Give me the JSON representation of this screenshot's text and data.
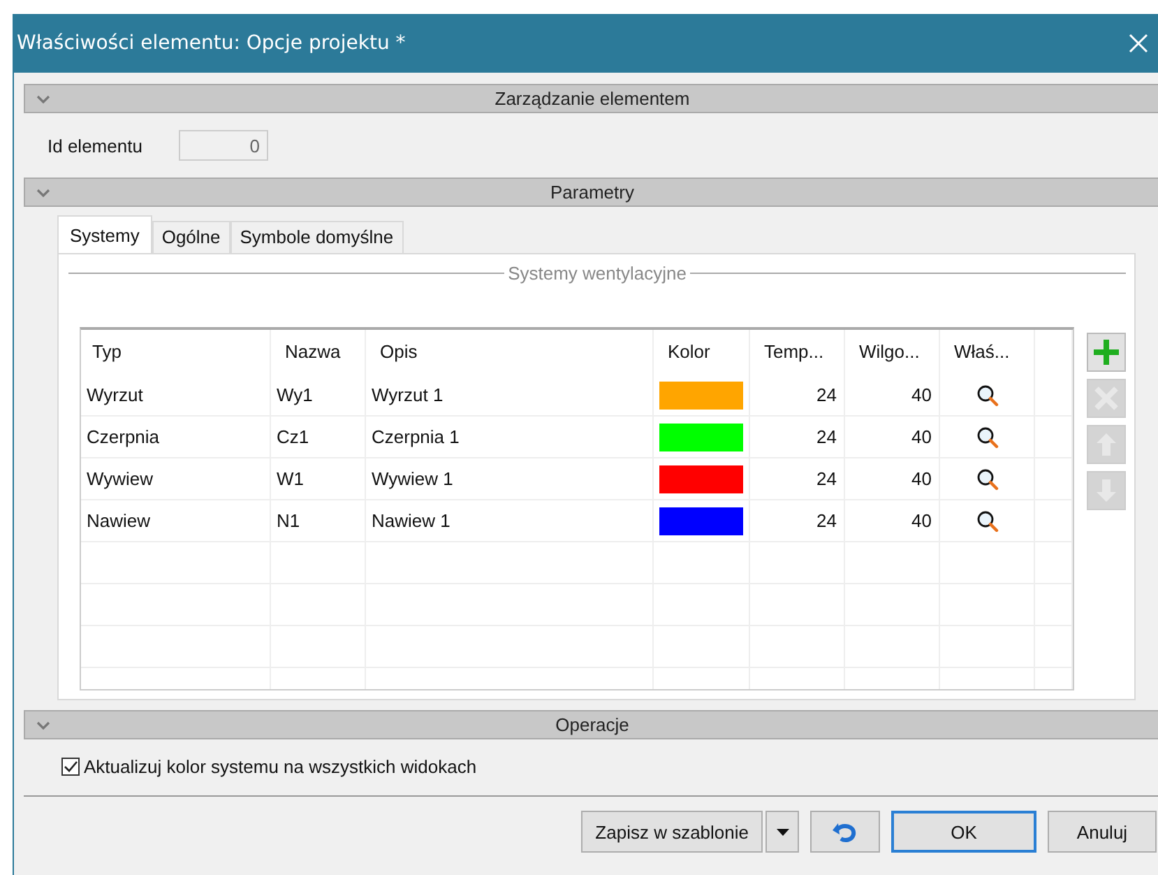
{
  "window": {
    "title": "Właściwości elementu: Opcje projektu *"
  },
  "sections": [
    {
      "title": "Zarządzanie elementem",
      "expanded": true
    },
    {
      "title": "Parametry",
      "expanded": true
    },
    {
      "title": "Operacje",
      "expanded": true
    }
  ],
  "id_field": {
    "label": "Id elementu",
    "value": "0",
    "disabled": true
  },
  "tabs": [
    {
      "label": "Systemy",
      "selected": true
    },
    {
      "label": "Ogólne",
      "selected": false
    },
    {
      "label": "Symbole domyślne",
      "selected": false
    }
  ],
  "group": {
    "title": "Systemy wentylacyjne"
  },
  "table": {
    "columns": [
      "Typ",
      "Nazwa",
      "Opis",
      "Kolor",
      "Temp...",
      "Wilgo...",
      "Właś..."
    ],
    "rows": [
      {
        "typ": "Wyrzut",
        "nazwa": "Wy1",
        "opis": "Wyrzut 1",
        "color": "#ffa500",
        "temp": "24",
        "wilg": "40"
      },
      {
        "typ": "Czerpnia",
        "nazwa": "Cz1",
        "opis": "Czerpnia 1",
        "color": "#00ff00",
        "temp": "24",
        "wilg": "40"
      },
      {
        "typ": "Wywiew",
        "nazwa": "W1",
        "opis": "Wywiew 1",
        "color": "#ff0000",
        "temp": "24",
        "wilg": "40"
      },
      {
        "typ": "Nawiew",
        "nazwa": "N1",
        "opis": "Nawiew 1",
        "color": "#0000ff",
        "temp": "24",
        "wilg": "40"
      }
    ]
  },
  "tools": [
    {
      "kind": "add",
      "disabled": false
    },
    {
      "kind": "delete",
      "disabled": true
    },
    {
      "kind": "up",
      "disabled": true
    },
    {
      "kind": "down",
      "disabled": true
    }
  ],
  "checkbox": {
    "label": "Aktualizuj kolor systemu na wszystkich widokach",
    "checked": true
  },
  "buttons": [
    {
      "kind": "text",
      "label": "Zapisz w szablonie"
    },
    {
      "kind": "dropdown"
    },
    {
      "kind": "undo"
    },
    {
      "kind": "default",
      "label": "OK"
    },
    {
      "kind": "text",
      "label": "Anuluj"
    }
  ]
}
